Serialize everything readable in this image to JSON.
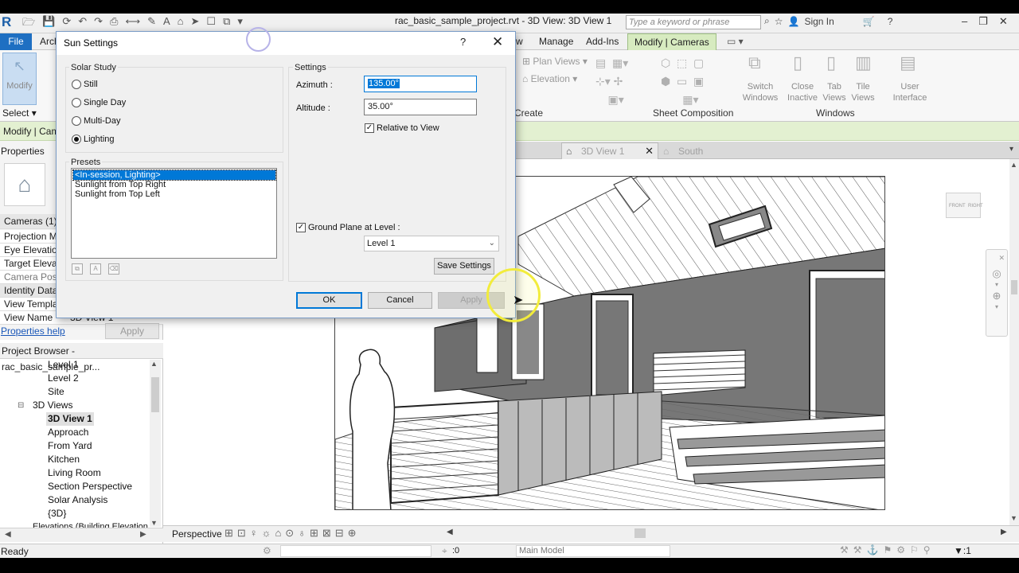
{
  "window": {
    "title": "rac_basic_sample_project.rvt - 3D View: 3D View 1",
    "search_placeholder": "Type a keyword or phrase",
    "sign_in": "Sign In"
  },
  "ribbon": {
    "tabs": {
      "file": "File",
      "architecture": "Arch",
      "view": "w",
      "manage": "Manage",
      "addins": "Add-Ins",
      "modify_cameras": "Modify | Cameras"
    },
    "modify_label": "Modify",
    "select_label": "Select",
    "plan_views": "Plan Views",
    "elevation": "Elevation",
    "create_panel": "Create",
    "sheet_composition": "Sheet Composition",
    "switch_windows": "Switch Windows",
    "close_inactive": "Close Inactive",
    "tab_views": "Tab Views",
    "tile_views": "Tile Views",
    "user_interface": "User Interface",
    "windows_panel": "Windows"
  },
  "context_bar": {
    "text": "Modify | Cam"
  },
  "properties": {
    "title": "Properties",
    "type_selector": "Cameras (1)",
    "rows": {
      "projection_mode": "Projection M",
      "eye_elevation": "Eye Elevation",
      "target_elevation": "Target Elevat",
      "camera_position": "Camera Posit",
      "identity_data": "Identity Data",
      "view_template": "View Templa",
      "view_name": "View Name",
      "view_name_value": "3D View 1"
    },
    "help_link": "Properties help",
    "apply_label": "Apply"
  },
  "project_browser": {
    "title": "Project Browser - rac_basic_sample_pr...",
    "items": {
      "level1": "Level 1",
      "level2": "Level 2",
      "site": "Site",
      "views3d": "3D Views",
      "view3d1": "3D View 1",
      "approach": "Approach",
      "from_yard": "From Yard",
      "kitchen": "Kitchen",
      "living_room": "Living Room",
      "section_perspective": "Section Perspective",
      "solar_analysis": "Solar Analysis",
      "default3d": "{3D}",
      "elevations": "Elevations (Building Elevation"
    }
  },
  "view_tabs": {
    "active": "3D View 1",
    "inactive": "South"
  },
  "view_control_bar": {
    "mode": "Perspective"
  },
  "status_bar": {
    "ready": "Ready",
    "count": ":0",
    "model": "Main Model"
  },
  "nav_cube": {
    "front": "FRONT",
    "right": "RIGHT"
  },
  "dialog": {
    "title": "Sun Settings",
    "help_glyph": "?",
    "close_glyph": "✕",
    "solar_study": {
      "label": "Solar Study",
      "options": {
        "still": "Still",
        "single_day": "Single Day",
        "multi_day": "Multi-Day",
        "lighting": "Lighting"
      },
      "selected": "Lighting"
    },
    "presets": {
      "label": "Presets",
      "items": [
        "<In-session, Lighting>",
        "Sunlight from Top Right",
        "Sunlight from Top Left"
      ]
    },
    "settings": {
      "label": "Settings",
      "azimuth_label": "Azimuth :",
      "azimuth_value": "135.00°",
      "altitude_label": "Altitude :",
      "altitude_value": "35.00°",
      "relative_to_view": "Relative to View",
      "ground_plane": "Ground Plane at Level :",
      "level_value": "Level 1",
      "save_settings": "Save Settings"
    },
    "buttons": {
      "ok": "OK",
      "cancel": "Cancel",
      "apply": "Apply"
    }
  },
  "colors": {
    "file_tab": "#1e6fc2",
    "context_tab": "#d7ebc0",
    "selection": "#0078d7",
    "cursor_highlight": "#f2ec3b"
  }
}
